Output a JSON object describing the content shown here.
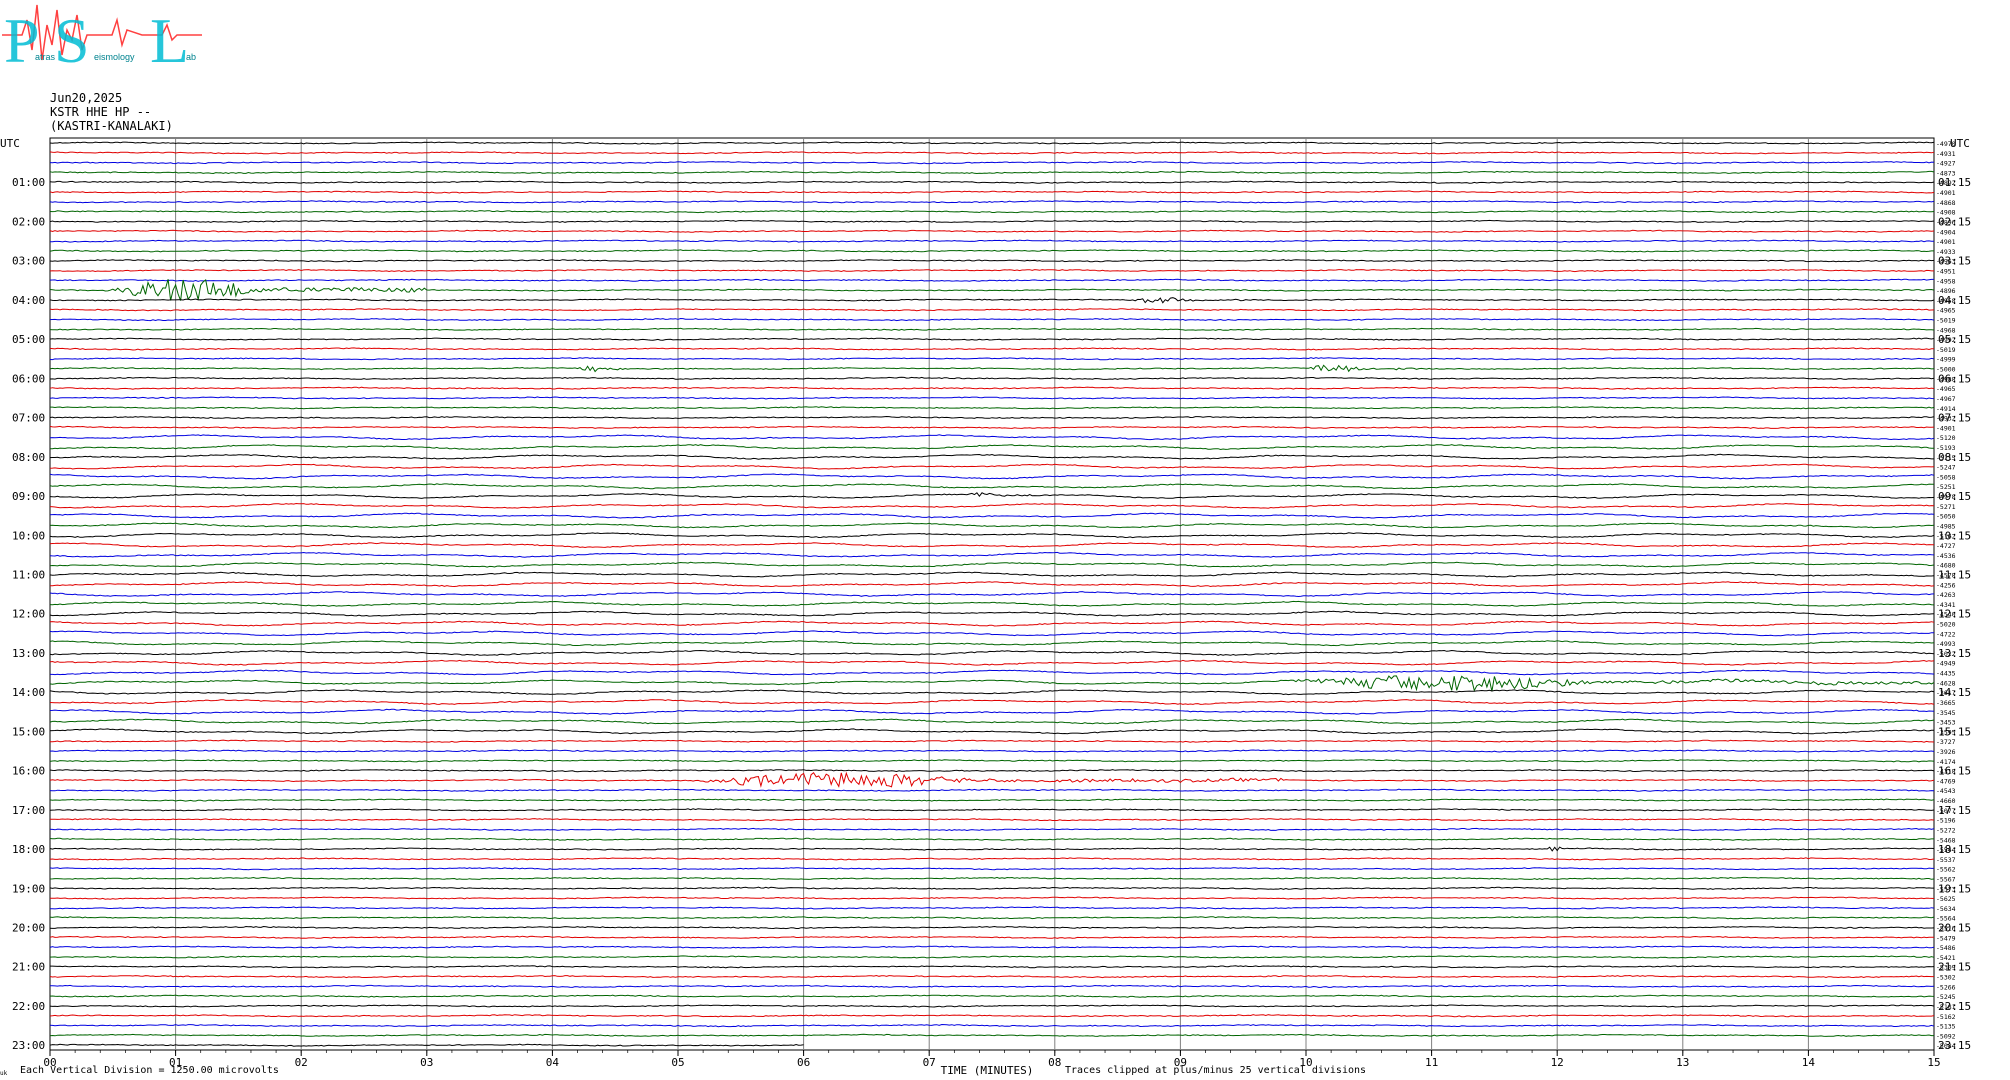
{
  "logo": {
    "letters": [
      "P",
      "S",
      "L"
    ],
    "small_words": [
      "atras",
      "eismology",
      "ab"
    ]
  },
  "header": {
    "date": "Jun20,2025",
    "station": "KSTR HHE HP --",
    "location": "(KASTRI-KANALAKI)"
  },
  "chart_data": {
    "type": "line",
    "description_type": "helicorder",
    "left_axis_title": "UTC",
    "right_axis_title": "UTC",
    "left_hour_labels": [
      "01:00",
      "02:00",
      "03:00",
      "04:00",
      "05:00",
      "06:00",
      "07:00",
      "08:00",
      "09:00",
      "10:00",
      "11:00",
      "12:00",
      "13:00",
      "14:00",
      "15:00",
      "16:00",
      "17:00",
      "18:00",
      "19:00",
      "20:00",
      "21:00",
      "22:00",
      "23:00"
    ],
    "right_hour_labels": [
      "01:15",
      "02:15",
      "03:15",
      "04:15",
      "05:15",
      "06:15",
      "07:15",
      "08:15",
      "09:15",
      "10:15",
      "11:15",
      "12:15",
      "13:15",
      "14:15",
      "15:15",
      "16:15",
      "17:15",
      "18:15",
      "19:15",
      "20:15",
      "21:15",
      "22:15",
      "23:15"
    ],
    "x_ticks": [
      "00",
      "01",
      "02",
      "03",
      "04",
      "05",
      "06",
      "07",
      "08",
      "09",
      "10",
      "11",
      "12",
      "13",
      "14",
      "15"
    ],
    "xlim": [
      0,
      15
    ],
    "xlabel": "TIME (MINUTES)",
    "trace_count": 93,
    "last_trace_end_minute": 6,
    "trace_colors": [
      "#000000",
      "#e00000",
      "#0000e0",
      "#006400"
    ],
    "grid_color": "#808080",
    "right_mean_values": [
      "-4970",
      "-4931",
      "-4927",
      "-4873",
      "-4892",
      "-4901",
      "-4868",
      "-4908",
      "-4896",
      "-4904",
      "-4901",
      "-4933",
      "-4963",
      "-4951",
      "-4958",
      "-4896",
      "-4958",
      "-4965",
      "-5019",
      "-4968",
      "-4992",
      "-5019",
      "-4999",
      "-5000",
      "-4988",
      "-4965",
      "-4967",
      "-4914",
      "-4932",
      "-4901",
      "-5120",
      "-5193",
      "-5115",
      "-5247",
      "-5058",
      "-5251",
      "-4978",
      "-5271",
      "-5050",
      "-4985",
      "-5162",
      "-4727",
      "-4536",
      "-4680",
      "-4578",
      "-4256",
      "-4263",
      "-4341",
      "-4540",
      "-5020",
      "-4722",
      "-4993",
      "-5022",
      "-4949",
      "-4435",
      "-4628",
      "-3617",
      "-3665",
      "-3545",
      "-3453",
      "-3595",
      "-3727",
      "-3926",
      "-4174",
      "-4318",
      "-4769",
      "-4543",
      "-4660",
      "-5077",
      "-5196",
      "-5272",
      "-5468",
      "-5544",
      "-5537",
      "-5562",
      "-5567",
      "-5573",
      "-5625",
      "-5634",
      "-5564",
      "-5516",
      "-5479",
      "-5486",
      "-5421",
      "-5309",
      "-5302",
      "-5266",
      "-5245",
      "-5181",
      "-5162",
      "-5135",
      "-5092",
      "-5084"
    ],
    "events": [
      {
        "trace": 15,
        "start_min": 0.5,
        "end_min": 3.0,
        "amp": 3.4
      },
      {
        "trace": 16,
        "start_min": 8.6,
        "end_min": 9.6,
        "amp": 0.9
      },
      {
        "trace": 23,
        "start_min": 4.2,
        "end_min": 4.6,
        "amp": 1.2
      },
      {
        "trace": 23,
        "start_min": 10.0,
        "end_min": 11.0,
        "amp": 1.2
      },
      {
        "trace": 36,
        "start_min": 7.3,
        "end_min": 7.8,
        "amp": 1.0
      },
      {
        "trace": 55,
        "start_min": 9.9,
        "end_min": 15.0,
        "amp": 2.4
      },
      {
        "trace": 65,
        "start_min": 5.2,
        "end_min": 9.8,
        "amp": 2.3
      },
      {
        "trace": 72,
        "start_min": 11.9,
        "end_min": 12.3,
        "amp": 0.8
      }
    ]
  },
  "footer": {
    "left_note": "Each Vertical Division = 1250.00 microvolts",
    "right_note": "Traces clipped at plus/minus 25 vertical divisions",
    "corner_mark": "uk"
  }
}
